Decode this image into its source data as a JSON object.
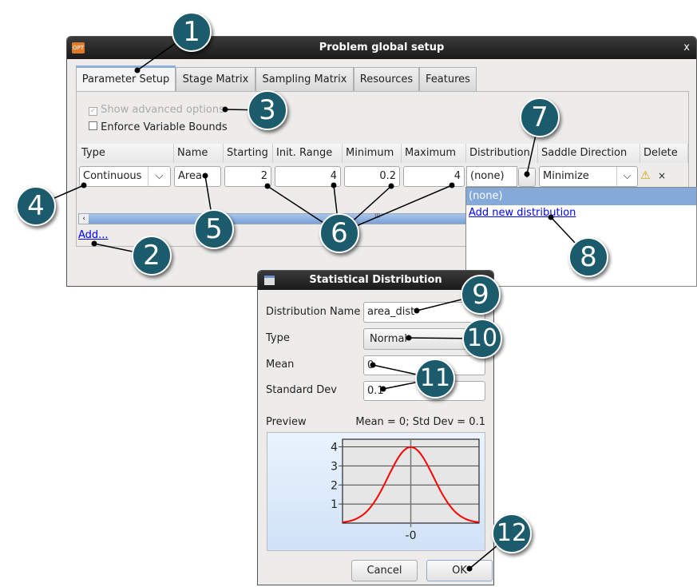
{
  "window": {
    "title": "Problem global setup",
    "app_icon": "OPT",
    "close": "x"
  },
  "tabs": [
    {
      "label": "Parameter Setup",
      "active": true
    },
    {
      "label": "Stage Matrix"
    },
    {
      "label": "Sampling Matrix"
    },
    {
      "label": "Resources"
    },
    {
      "label": "Features"
    }
  ],
  "options": {
    "show_advanced": {
      "label": "Show advanced options",
      "checked": true,
      "disabled": true
    },
    "enforce_bounds": {
      "label": "Enforce Variable Bounds",
      "checked": false
    }
  },
  "table": {
    "headers": [
      "Type",
      "Name",
      "Starting",
      "Init. Range",
      "Minimum",
      "Maximum",
      "Distribution",
      "Saddle Direction",
      "Delete"
    ],
    "row": {
      "type": "Continuous",
      "name": "Area",
      "starting": "2",
      "init_range": "4",
      "minimum": "0.2",
      "maximum": "4",
      "distribution": "(none)",
      "saddle": "Minimize",
      "delete": "×"
    },
    "scroll_grip": "III"
  },
  "add_link": "Add...",
  "distribution_popup": {
    "items": [
      "(none)",
      "Add new distribution"
    ]
  },
  "dialog": {
    "title": "Statistical Distribution",
    "name_label": "Distribution Name",
    "name_value": "area_dist",
    "type_label": "Type",
    "type_value": "Normal",
    "mean_label": "Mean",
    "mean_value": "0",
    "std_label": "Standard Dev",
    "std_value": "0.1",
    "preview_label": "Preview",
    "preview_summary": "Mean = 0; Std Dev = 0.1",
    "cancel": "Cancel",
    "ok": "OK"
  },
  "chart_data": {
    "type": "line",
    "distribution": "normal",
    "mean": 0,
    "std": 0.1,
    "xlim": [
      -0.3,
      0.3
    ],
    "ylim": [
      0,
      4.4
    ],
    "yticks": [
      "1",
      "2",
      "3",
      "4"
    ],
    "xticks": [
      "-0"
    ],
    "grid": true,
    "line_color": "#ff0000"
  },
  "callouts": [
    "1",
    "2",
    "3",
    "4",
    "5",
    "6",
    "7",
    "8",
    "9",
    "10",
    "11",
    "12"
  ],
  "colors": {
    "callout": "#1c5b6b",
    "selection": "#85a9d8",
    "link": "#0000ff"
  }
}
